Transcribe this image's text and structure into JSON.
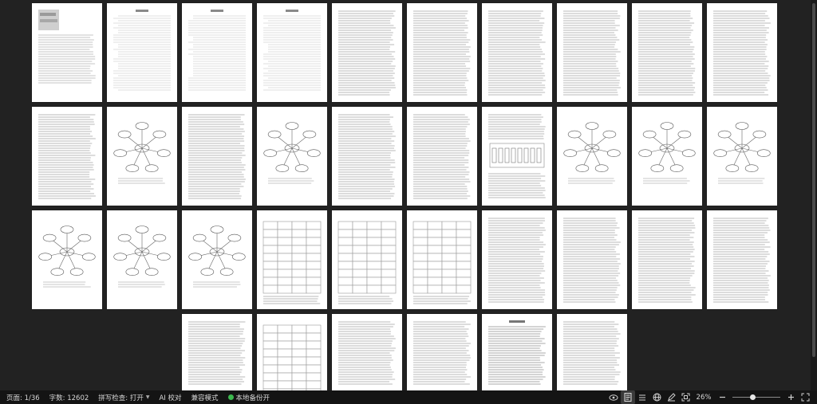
{
  "status_bar": {
    "page_label": "页面: 1/36",
    "word_count_label": "字数: 12602",
    "spell_check_label": "拼写检查: 打开",
    "ai_check_label": "AI 校对",
    "compat_mode_label": "兼容模式",
    "backup_label": "本地备份开",
    "zoom_label": "26%",
    "zoom_value_percent": 26
  },
  "document": {
    "page_count_visible": 36,
    "page_icons": [
      "text-page",
      "outline-page",
      "mindmap-page",
      "table-page",
      "figure-page",
      "reference-page"
    ]
  },
  "colors": {
    "canvas_bg": "#222222",
    "statusbar_bg": "#141414",
    "backup_indicator": "#3db94f"
  }
}
